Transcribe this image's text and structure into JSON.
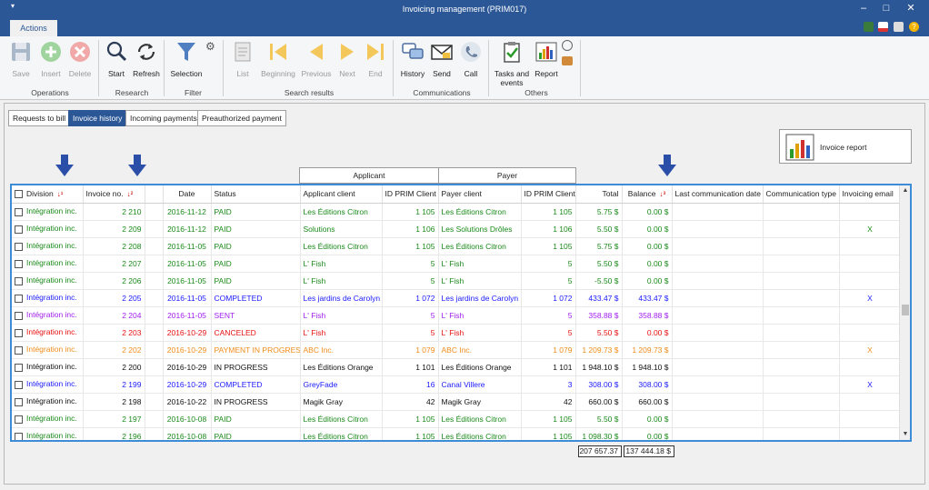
{
  "window": {
    "title": "Invoicing management (PRIM017)"
  },
  "ribbon_tab": "Actions",
  "ribbon": {
    "groups": [
      {
        "label": "Operations"
      },
      {
        "label": "Research"
      },
      {
        "label": "Filter"
      },
      {
        "label": "Search results"
      },
      {
        "label": "Communications"
      },
      {
        "label": "Others"
      }
    ],
    "buttons": {
      "save": "Save",
      "insert": "Insert",
      "delete": "Delete",
      "start": "Start",
      "refresh": "Refresh",
      "selection": "Selection",
      "list": "List",
      "beginning": "Beginning",
      "previous": "Previous",
      "next": "Next",
      "end": "End",
      "history": "History",
      "send": "Send",
      "call": "Call",
      "tasks_events": "Tasks and events",
      "report": "Report"
    }
  },
  "subtabs": [
    "Requests to bill",
    "Invoice history",
    "Incoming payments",
    "Preauthorized payment"
  ],
  "invoice_report_button": "Invoice report",
  "group_headers": {
    "applicant": "Applicant",
    "payer": "Payer"
  },
  "columns": [
    "Division",
    "Invoice no.",
    "",
    "Date",
    "Status",
    "Applicant client",
    "ID PRIM Client",
    "Payer client",
    "ID PRIM Client",
    "Total",
    "Balance",
    "Last communication date",
    "Communication type",
    "Invoicing email"
  ],
  "colors": {
    "green": "#1a8a1a",
    "blue": "#1a1aff",
    "purple": "#a020f0",
    "red": "#e81010",
    "orange": "#f08c1a",
    "black": "#111111",
    "accent": "#2b5797"
  },
  "rows": [
    {
      "color": "green",
      "division": "Intégration inc.",
      "invoice": "2 210",
      "date": "2016-11-12",
      "status": "PAID",
      "applicant": "Les Éditions Citron",
      "app_id": "1 105",
      "payer": "Les Éditions Citron",
      "pay_id": "1 105",
      "total": "5.75 $",
      "balance": "0.00 $",
      "email": ""
    },
    {
      "color": "green",
      "division": "Intégration inc.",
      "invoice": "2 209",
      "date": "2016-11-12",
      "status": "PAID",
      "applicant": "Solutions",
      "app_id": "1 106",
      "payer": "Les Solutions Drôles",
      "pay_id": "1 106",
      "total": "5.50 $",
      "balance": "0.00 $",
      "email": "X"
    },
    {
      "color": "green",
      "division": "Intégration inc.",
      "invoice": "2 208",
      "date": "2016-11-05",
      "status": "PAID",
      "applicant": "Les Éditions Citron",
      "app_id": "1 105",
      "payer": "Les Éditions Citron",
      "pay_id": "1 105",
      "total": "5.75 $",
      "balance": "0.00 $",
      "email": ""
    },
    {
      "color": "green",
      "division": "Intégration inc.",
      "invoice": "2 207",
      "date": "2016-11-05",
      "status": "PAID",
      "applicant": "L' Fish",
      "app_id": "5",
      "payer": "L' Fish",
      "pay_id": "5",
      "total": "5.50 $",
      "balance": "0.00 $",
      "email": ""
    },
    {
      "color": "green",
      "division": "Intégration inc.",
      "invoice": "2 206",
      "date": "2016-11-05",
      "status": "PAID",
      "applicant": "L' Fish",
      "app_id": "5",
      "payer": "L' Fish",
      "pay_id": "5",
      "total": "-5.50 $",
      "balance": "0.00 $",
      "email": ""
    },
    {
      "color": "blue",
      "division": "Intégration inc.",
      "invoice": "2 205",
      "date": "2016-11-05",
      "status": "COMPLETED",
      "applicant": "Les jardins de Carolyn",
      "app_id": "1 072",
      "payer": "Les jardins de Carolyn",
      "pay_id": "1 072",
      "total": "433.47 $",
      "balance": "433.47 $",
      "email": "X"
    },
    {
      "color": "purple",
      "division": "Intégration inc.",
      "invoice": "2 204",
      "date": "2016-11-05",
      "status": "SENT",
      "applicant": "L' Fish",
      "app_id": "5",
      "payer": "L' Fish",
      "pay_id": "5",
      "total": "358.88 $",
      "balance": "358.88 $",
      "email": ""
    },
    {
      "color": "red",
      "division": "Intégration inc.",
      "invoice": "2 203",
      "date": "2016-10-29",
      "status": "CANCELED",
      "applicant": "L' Fish",
      "app_id": "5",
      "payer": "L' Fish",
      "pay_id": "5",
      "total": "5.50 $",
      "balance": "0.00 $",
      "email": ""
    },
    {
      "color": "orange",
      "division": "Intégration inc.",
      "invoice": "2 202",
      "date": "2016-10-29",
      "status": "PAYMENT IN PROGRESS",
      "applicant": "ABC Inc.",
      "app_id": "1 079",
      "payer": "ABC Inc.",
      "pay_id": "1 079",
      "total": "1 209.73 $",
      "balance": "1 209.73 $",
      "email": "X"
    },
    {
      "color": "black",
      "division": "Intégration inc.",
      "invoice": "2 200",
      "date": "2016-10-29",
      "status": "IN PROGRESS",
      "applicant": "Les Éditions Orange",
      "app_id": "1 101",
      "payer": "Les Éditions Orange",
      "pay_id": "1 101",
      "total": "1 948.10 $",
      "balance": "1 948.10 $",
      "email": ""
    },
    {
      "color": "blue",
      "division": "Intégration inc.",
      "invoice": "2 199",
      "date": "2016-10-29",
      "status": "COMPLETED",
      "applicant": "GreyFade",
      "app_id": "16",
      "payer": "Canal Villere",
      "pay_id": "3",
      "total": "308.00 $",
      "balance": "308.00 $",
      "email": "X"
    },
    {
      "color": "black",
      "division": "Intégration inc.",
      "invoice": "2 198",
      "date": "2016-10-22",
      "status": "IN PROGRESS",
      "applicant": "Magik Gray",
      "app_id": "42",
      "payer": "Magik Gray",
      "pay_id": "42",
      "total": "660.00 $",
      "balance": "660.00 $",
      "email": ""
    },
    {
      "color": "green",
      "division": "Intégration inc.",
      "invoice": "2 197",
      "date": "2016-10-08",
      "status": "PAID",
      "applicant": "Les Éditions Citron",
      "app_id": "1 105",
      "payer": "Les Éditions Citron",
      "pay_id": "1 105",
      "total": "5.50 $",
      "balance": "0.00 $",
      "email": ""
    },
    {
      "color": "green",
      "division": "Intégration inc.",
      "invoice": "2 196",
      "date": "2016-10-08",
      "status": "PAID",
      "applicant": "Les Éditions Citron",
      "app_id": "1 105",
      "payer": "Les Éditions Citron",
      "pay_id": "1 105",
      "total": "1 098.30 $",
      "balance": "0.00 $",
      "email": ""
    }
  ],
  "totals": {
    "total": "207 657.37",
    "balance": "137 444.18 $"
  }
}
